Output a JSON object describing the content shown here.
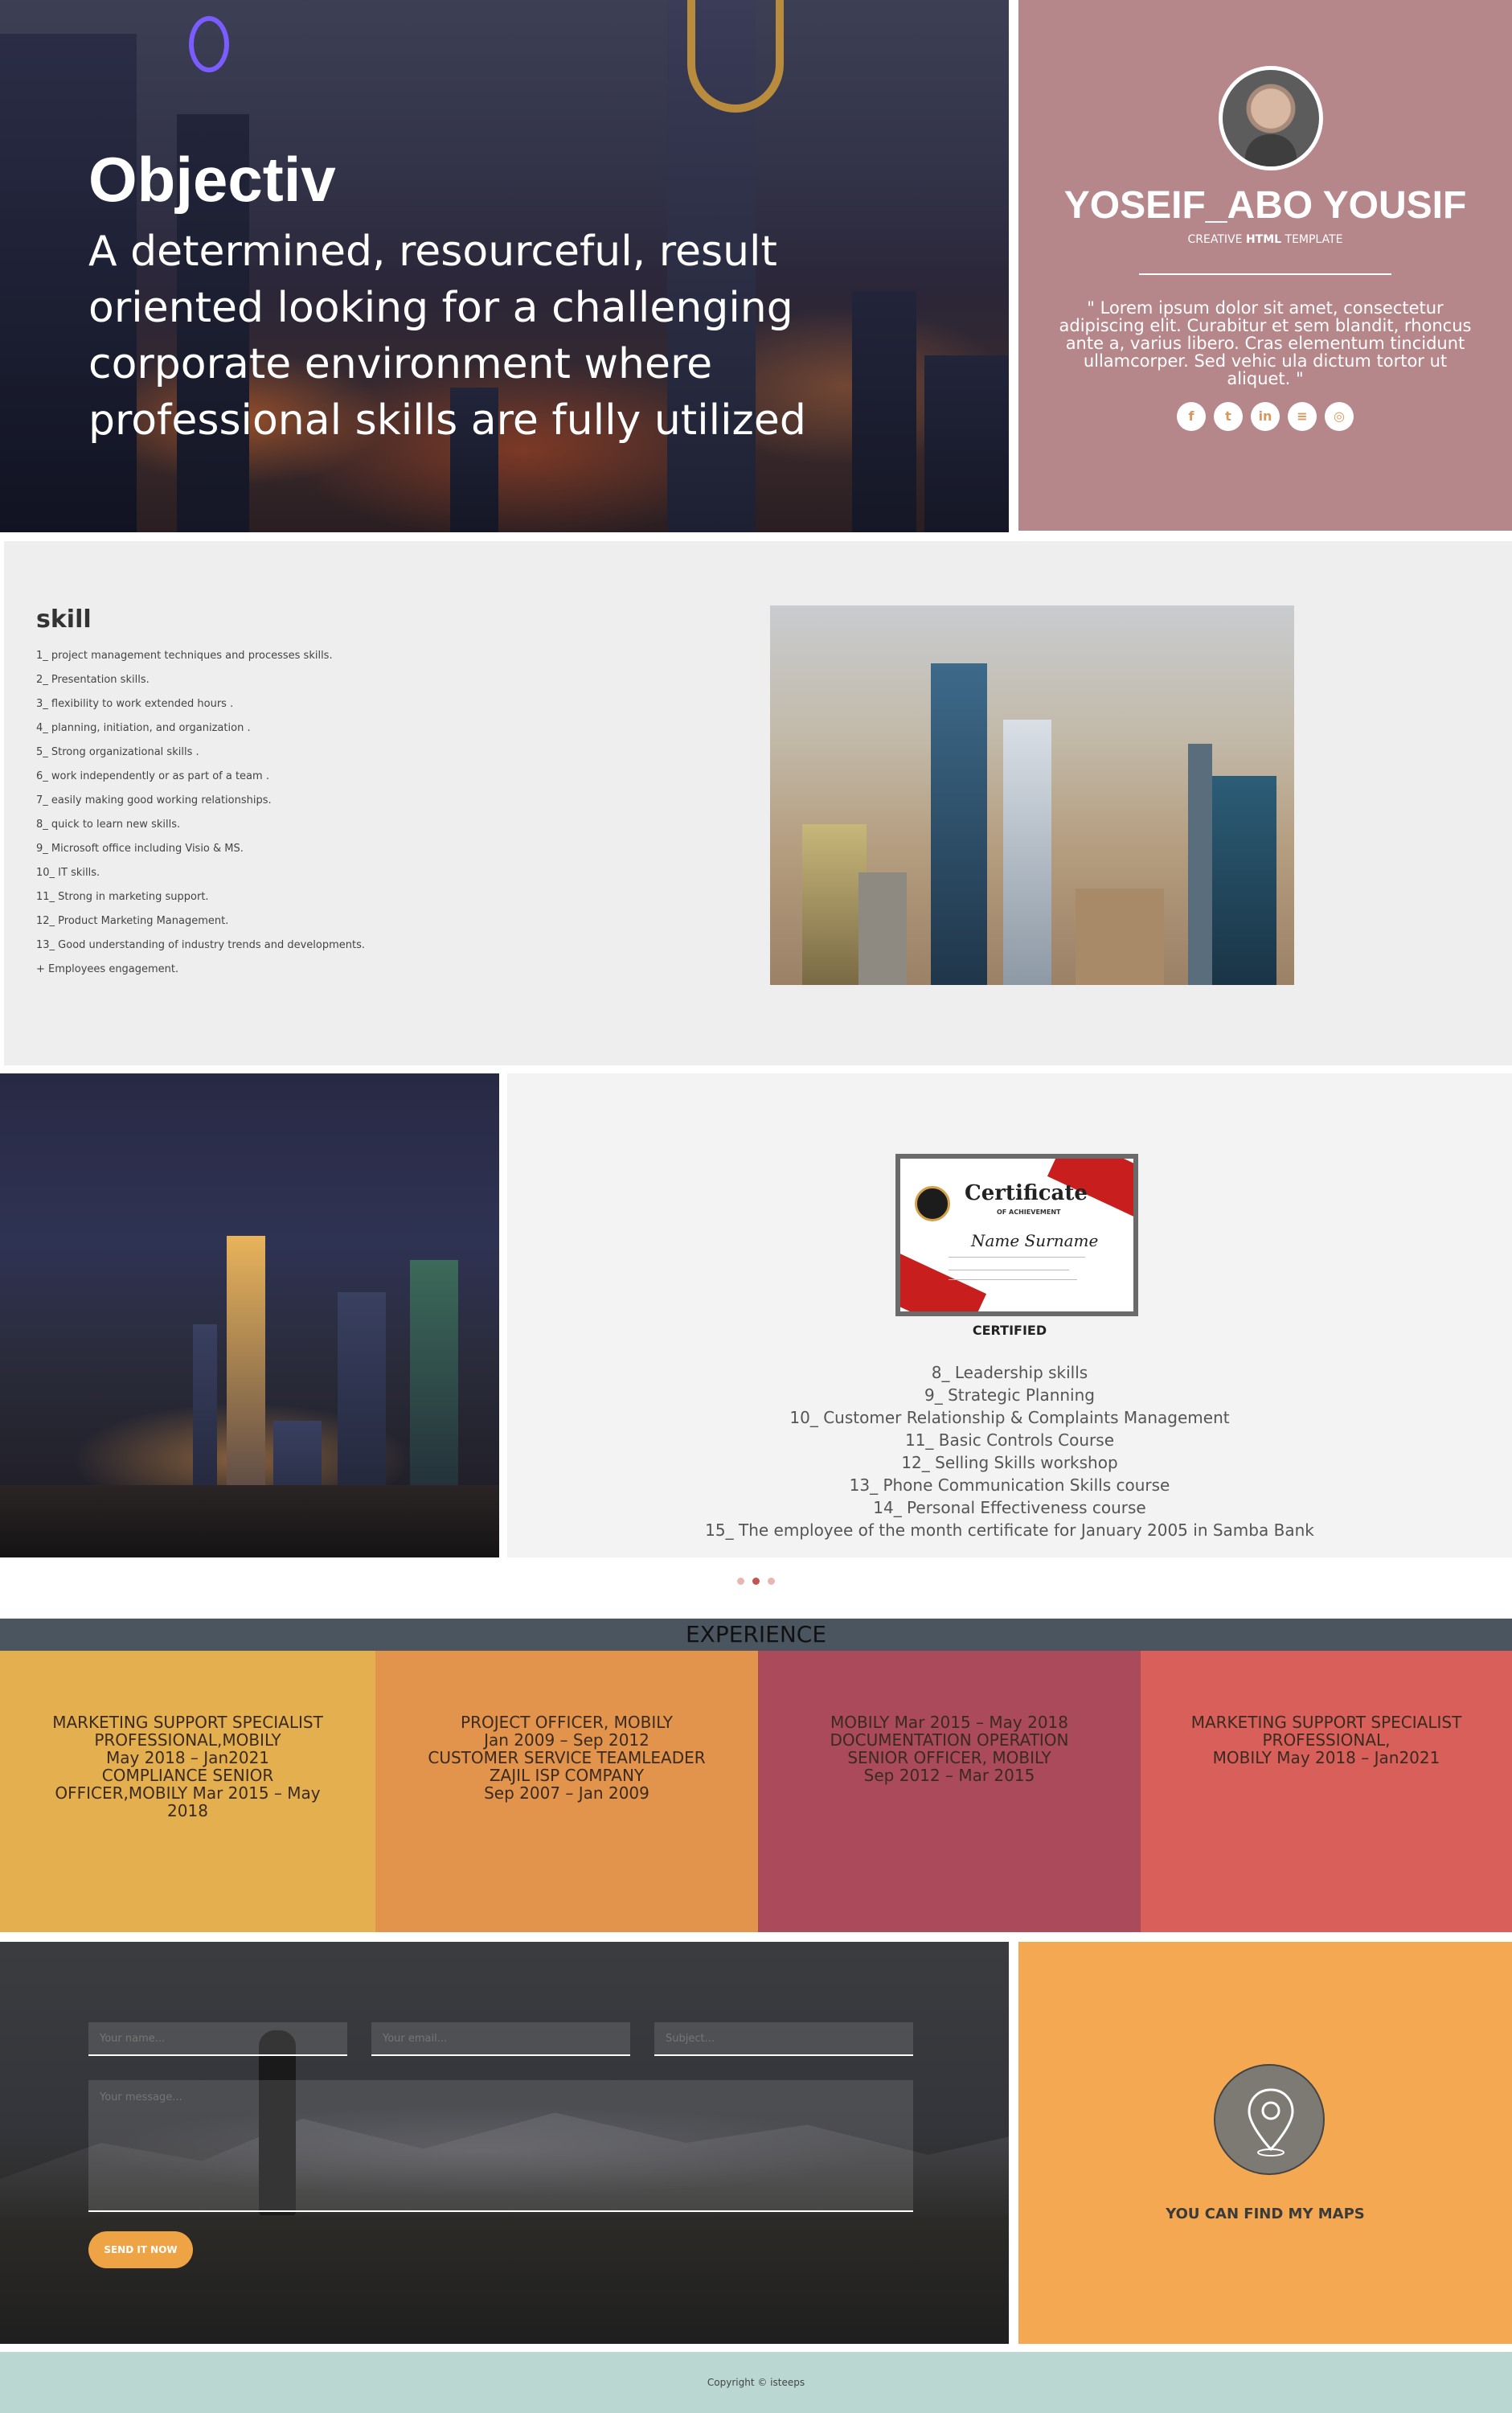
{
  "hero": {
    "title": "Objectiv",
    "text": "A determined, resourceful, result oriented looking for a challenging corporate environment where professional skills are fully utilized"
  },
  "profile": {
    "name": "YOSEIF_ABO YOUSIF",
    "subtitle_pre": "CREATIVE ",
    "subtitle_bold": "HTML",
    "subtitle_post": " TEMPLATE",
    "quote": "\" Lorem ipsum dolor sit amet, consectetur adipiscing elit. Curabitur et sem blandit, rhoncus ante a, varius libero. Cras elementum tincidunt ullamcorper. Sed vehic ula dictum tortor ut aliquet. \"",
    "socials": [
      {
        "icon": "facebook-icon",
        "glyph": "f"
      },
      {
        "icon": "twitter-icon",
        "glyph": "t"
      },
      {
        "icon": "linkedin-icon",
        "glyph": "in"
      },
      {
        "icon": "rss-icon",
        "glyph": "≡"
      },
      {
        "icon": "dribbble-icon",
        "glyph": "◎"
      }
    ]
  },
  "skills": {
    "title": "skill",
    "items": [
      "1_ project management techniques and processes skills.",
      "2_ Presentation skills.",
      "3_ flexibility to work extended hours .",
      "4_ planning, initiation, and organization .",
      "5_ Strong organizational skills .",
      "6_ work independently or as part of a team .",
      "7_ easily making good working relationships.",
      "8_ quick to learn new skills.",
      "9_ Microsoft office including Visio & MS.",
      "10_ IT skills.",
      "11_ Strong in marketing support.",
      "12_ Product Marketing Management.",
      "13_ Good understanding of industry trends and developments.",
      "+ Employees engagement."
    ]
  },
  "certificate": {
    "image_title": "Certificate",
    "image_subtitle": "OF ACHIEVEMENT",
    "image_name": "Name Surname",
    "caption": "CERTIFIED",
    "items": [
      "8_ Leadership skills",
      "9_ Strategic Planning",
      "10_ Customer Relationship & Complaints Management",
      "11_ Basic Controls Course",
      "12_ Selling Skills workshop",
      "13_ Phone Communication Skills course",
      "14_ Personal Effectiveness course",
      "15_ The employee of the month certificate for January 2005 in Samba Bank"
    ]
  },
  "experience": {
    "title": "EXPERIENCE",
    "columns": [
      {
        "text": "MARKETING SUPPORT SPECIALIST PROFESSIONAL,MOBILY\nMay 2018 – Jan2021\nCOMPLIANCE SENIOR OFFICER,MOBILY Mar 2015 – May 2018",
        "color": "#e4b04f"
      },
      {
        "text": "PROJECT OFFICER, MOBILY\nJan 2009 – Sep 2012\nCUSTOMER SERVICE TEAMLEADER\nZAJIL ISP COMPANY\nSep 2007 – Jan 2009",
        "color": "#e2944c"
      },
      {
        "text": "MOBILY Mar 2015 – May 2018\nDOCUMENTATION OPERATION SENIOR OFFICER, MOBILY\nSep 2012 – Mar 2015",
        "color": "#ab4a5b"
      },
      {
        "text": "MARKETING SUPPORT SPECIALIST PROFESSIONAL,\nMOBILY May 2018 – Jan2021",
        "color": "#d9605a"
      }
    ]
  },
  "contact": {
    "name_placeholder": "Your name...",
    "email_placeholder": "Your email...",
    "subject_placeholder": "Subject...",
    "message_placeholder": "Your message...",
    "send_label": "SEND IT NOW"
  },
  "map": {
    "label": "YOU CAN FIND MY MAPS"
  },
  "footer": {
    "text": "Copyright © isteeps"
  },
  "colors": {
    "profile_bg": "#b5878a",
    "accent_orange": "#f4a852",
    "button": "#eea345",
    "footer_bg": "#bad7d1",
    "experience_header": "#4b5560"
  }
}
